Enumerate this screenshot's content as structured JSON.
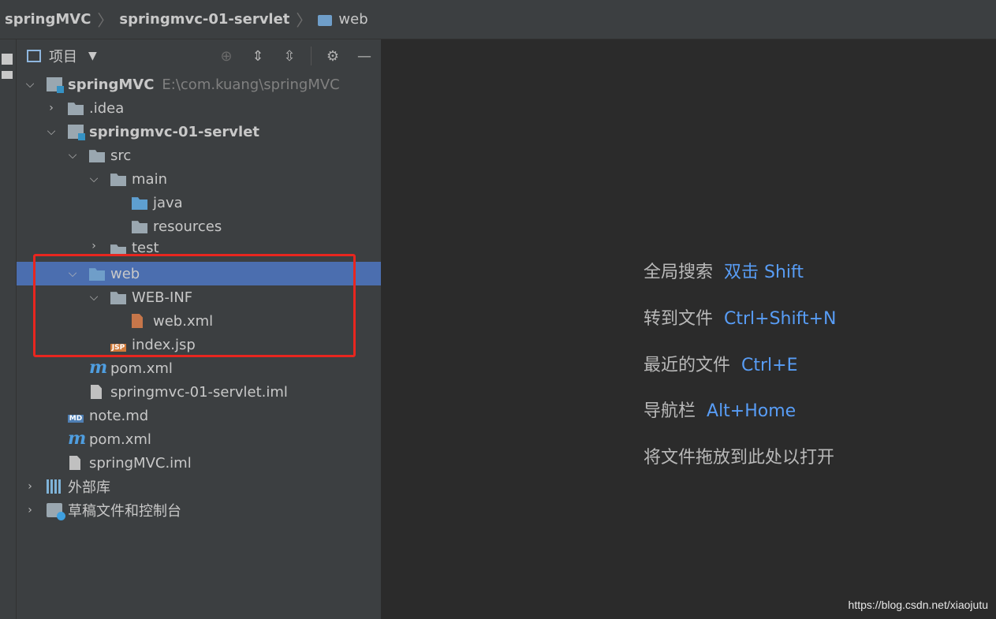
{
  "breadcrumb": {
    "items": [
      "springMVC",
      "springmvc-01-servlet",
      "web"
    ]
  },
  "panel": {
    "title": "项目",
    "tools": [
      "locate-icon",
      "expand-all-icon",
      "collapse-all-icon",
      "gear-icon",
      "minimize-icon"
    ]
  },
  "tree": {
    "root_name": "springMVC",
    "root_path": "E:\\com.kuang\\springMVC",
    "idea": ".idea",
    "module": "springmvc-01-servlet",
    "src": "src",
    "main": "main",
    "java": "java",
    "resources": "resources",
    "test": "test",
    "web": "web",
    "webinf": "WEB-INF",
    "webxml": "web.xml",
    "indexjsp": "index.jsp",
    "pom_module": "pom.xml",
    "module_iml": "springmvc-01-servlet.iml",
    "notemd": "note.md",
    "pom_root": "pom.xml",
    "root_iml": "springMVC.iml",
    "external": "外部库",
    "scratches": "草稿文件和控制台",
    "jsp_badge": "JSP",
    "md_badge": "MD",
    "m_glyph": "m"
  },
  "hints": [
    {
      "text": "全局搜索",
      "key": "双击 Shift"
    },
    {
      "text": "转到文件",
      "key": "Ctrl+Shift+N"
    },
    {
      "text": "最近的文件",
      "key": "Ctrl+E"
    },
    {
      "text": "导航栏",
      "key": "Alt+Home"
    },
    {
      "text": "将文件拖放到此处以打开",
      "key": ""
    }
  ],
  "colors": {
    "selection": "#4b6eaf",
    "annotation_red": "#e8261f",
    "shortcut_blue": "#589df6"
  },
  "watermark": "https://blog.csdn.net/xiaojutu"
}
